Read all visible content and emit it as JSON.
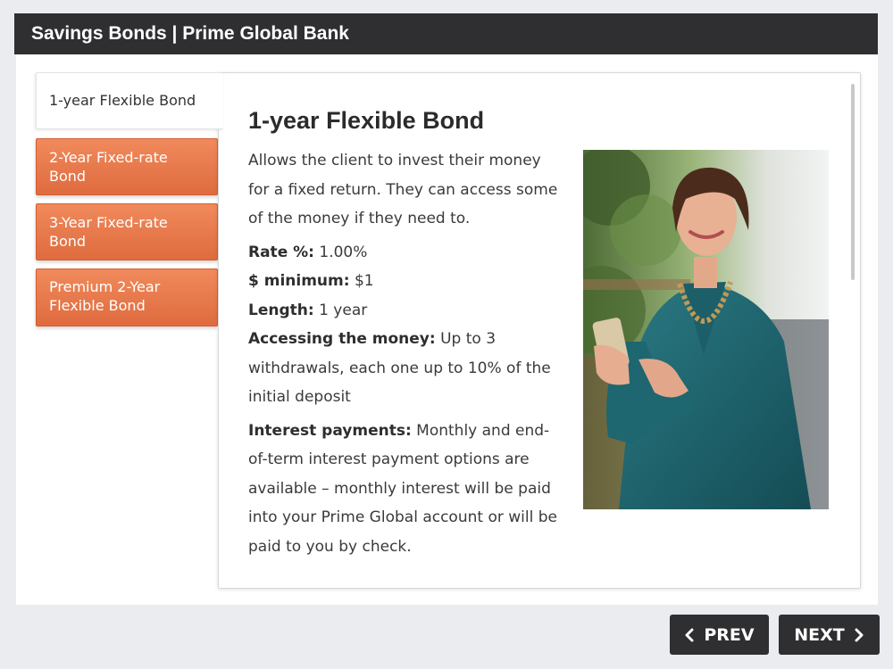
{
  "header": {
    "title": "Savings Bonds | Prime Global Bank"
  },
  "tabs": [
    {
      "label": "1-year Flexible Bond",
      "active": true
    },
    {
      "label": "2-Year Fixed-rate Bond",
      "active": false
    },
    {
      "label": "3-Year Fixed-rate Bond",
      "active": false
    },
    {
      "label": "Premium 2-Year Flexible Bond",
      "active": false
    }
  ],
  "content": {
    "title": "1-year Flexible Bond",
    "intro": "Allows the client to invest their money for a fixed return. They can access some of the money if they need to.",
    "rate_label": "Rate %:",
    "rate_value": "1.00%",
    "minimum_label": "$ minimum:",
    "minimum_value": "$1",
    "length_label": "Length:",
    "length_value": "1 year",
    "access_label": "Accessing the money:",
    "access_value": "Up to 3 withdrawals, each one up to 10% of the initial deposit",
    "interest_label": "Interest payments:",
    "interest_value": "Monthly and end-of-term interest payment options are available – monthly interest will be paid into your Prime Global account or will be paid to you by check.",
    "photo": "woman-smiling-holding-phone"
  },
  "nav": {
    "prev_label": "PREV",
    "next_label": "NEXT"
  },
  "colors": {
    "accent": "#e5764a",
    "dark": "#2f2f31"
  }
}
